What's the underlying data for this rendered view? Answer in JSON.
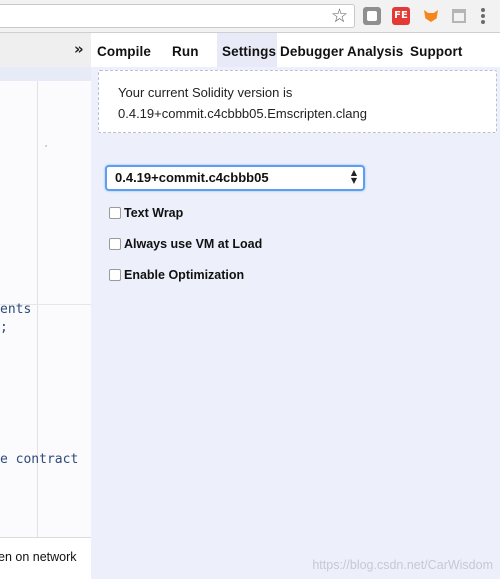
{
  "browser": {
    "extensions": {
      "fe_label": "FE"
    }
  },
  "remix": {
    "tabs": [
      {
        "label": "Compile"
      },
      {
        "label": "Run"
      },
      {
        "label": "Settings"
      },
      {
        "label": "Debugger"
      },
      {
        "label": "Analysis"
      },
      {
        "label": "Support"
      }
    ],
    "active_tab": "Settings"
  },
  "editor": {
    "code_lines": [
      "ents",
      ";",
      "e contract"
    ],
    "bottom_text": "en on network"
  },
  "settings": {
    "version_info_line1": "Your current Solidity version is",
    "version_info_line2": "0.4.19+commit.c4cbbb05.Emscripten.clang",
    "version_select_value": "0.4.19+commit.c4cbbb05",
    "options": [
      {
        "label": "Text Wrap",
        "checked": false
      },
      {
        "label": "Always use VM at Load",
        "checked": false
      },
      {
        "label": "Enable Optimization",
        "checked": false
      }
    ]
  },
  "watermark": "https://blog.csdn.net/CarWisdom"
}
